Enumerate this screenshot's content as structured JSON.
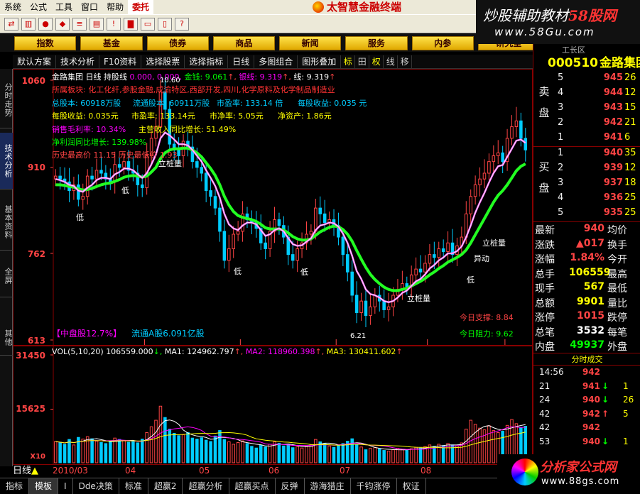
{
  "menu": [
    "系统",
    "公式",
    "工具",
    "窗口",
    "帮助",
    "委托"
  ],
  "app_title": "太智慧金融终端",
  "nav_buttons": [
    "指数",
    "基金",
    "债券",
    "商品",
    "新闻",
    "服务",
    "内参",
    "研究室"
  ],
  "watermark_top": {
    "line1_a": "炒股辅助教材",
    "line1_b": "58股网",
    "line2": "www.58Gu.com"
  },
  "subbar": [
    "默认方案",
    "技术分析",
    "F10资料",
    "选择股票",
    "选择指标",
    "日线",
    "多图组合",
    "图形叠加"
  ],
  "subbar_icons": [
    "标",
    "田",
    "权",
    "线",
    "移"
  ],
  "left_tabs": [
    "分时走势",
    "技术分析",
    "基本资料",
    "全屏",
    "其他"
  ],
  "main_info": {
    "title": "金路集团",
    "period": "日线",
    "line_label": "持股线",
    "vals": "0.000, 0.000,",
    "money_label": "金钱:",
    "money_val": "9.061",
    "gold_label": "银线:",
    "gold_val": "9.319",
    "line_label2": "线:",
    "line_val2": "9.319",
    "sector": "所属板块: 化工化纤,参股金融,成渝特区,西部开发,四川,化学原料及化学制品制造业",
    "total_shares": "总股本: 60918万股",
    "float_shares": "流通股本: 60911万股",
    "pe": "市盈率: 133.14 倍",
    "eps": "每股收益: 0.035 元",
    "eps2": "每股收益: 0.035元",
    "mktpe": "市盈率: 133.14元",
    "pb": "市净率: 5.05元",
    "nav": "净资产: 1.86元",
    "gross_margin": "销售毛利率: 10.34%",
    "rev_growth": "主营收入同比增长: 51.49%",
    "profit_growth": "净利润同比增长: 139.98%",
    "hist_high": "历史最高价 11.15 历史最低价 1.93",
    "cap_type": "【中盘股12.7%】",
    "float_cap": "流通A股6.091亿股",
    "support": "今日支撑: 8.84",
    "resistance": "今日阻力: 9.62",
    "price_hi_note": "10.60",
    "price_lo_note": "6.21"
  },
  "main_ylabels": [
    "1060",
    "910",
    "762",
    "613"
  ],
  "annotations": {
    "low": "低",
    "lizhuang": "立桩量",
    "yidong": "异动"
  },
  "vol_info": {
    "label": "VOL(5,10,20)",
    "vol": "106559.000",
    "ma1": "MA1: 124962.797",
    "ma2": "MA2: 118960.398",
    "ma3": "MA3: 130411.602"
  },
  "vol_ylabels": [
    "31450",
    "15625",
    "X10"
  ],
  "dates": [
    "2010/03",
    "04",
    "05",
    "06",
    "07",
    "08"
  ],
  "day_label": "日线",
  "bottom_tabs": [
    "指标",
    "模板",
    "I",
    "Dde决策",
    "标准",
    "超赢2",
    "超赢分析",
    "超赢买点",
    "反弹",
    "游海猎庄",
    "千钧涨停",
    "权证"
  ],
  "quote": {
    "code": "000510",
    "name": "金路集团",
    "right_tag": "工长区",
    "sell_label": "卖盘",
    "buy_label": "买盘",
    "sell": [
      {
        "n": "5",
        "p": "945",
        "v": "26"
      },
      {
        "n": "4",
        "p": "944",
        "v": "12"
      },
      {
        "n": "3",
        "p": "943",
        "v": "15"
      },
      {
        "n": "2",
        "p": "942",
        "v": "21"
      },
      {
        "n": "1",
        "p": "941",
        "v": "6"
      }
    ],
    "buy": [
      {
        "n": "1",
        "p": "940",
        "v": "35"
      },
      {
        "n": "2",
        "p": "939",
        "v": "12"
      },
      {
        "n": "3",
        "p": "937",
        "v": "18"
      },
      {
        "n": "4",
        "p": "936",
        "v": "25"
      },
      {
        "n": "5",
        "p": "935",
        "v": "25"
      }
    ],
    "stats": [
      {
        "k": "最新",
        "v": "940",
        "c": "#f44",
        "k2": "均价"
      },
      {
        "k": "涨跌",
        "v": "▲017",
        "c": "#f44",
        "k2": "换手"
      },
      {
        "k": "涨幅",
        "v": "1.84%",
        "c": "#f44",
        "k2": "今开"
      },
      {
        "k": "总手",
        "v": "106559",
        "c": "#ff0",
        "k2": "最高"
      },
      {
        "k": "现手",
        "v": "567",
        "c": "#ff0",
        "k2": "最低"
      },
      {
        "k": "总额",
        "v": "9901",
        "c": "#ff0",
        "k2": "量比"
      },
      {
        "k": "涨停",
        "v": "1015",
        "c": "#f44",
        "k2": "跌停"
      },
      {
        "k": "总笔",
        "v": "3532",
        "c": "#fff",
        "k2": "每笔"
      },
      {
        "k": "内盘",
        "v": "49937",
        "c": "#0f0",
        "k2": "外盘"
      }
    ],
    "ticks_title": "分时成交",
    "ticks": [
      {
        "t": "14:56",
        "p": "942",
        "a": "",
        "v": ""
      },
      {
        "t": "21",
        "p": "941",
        "a": "↓",
        "v": "1"
      },
      {
        "t": "24",
        "p": "940",
        "a": "↓",
        "v": "26"
      },
      {
        "t": "42",
        "p": "942",
        "a": "↑",
        "v": "5"
      },
      {
        "t": "42",
        "p": "942",
        "a": "",
        "v": ""
      },
      {
        "t": "53",
        "p": "940",
        "a": "↓",
        "v": "1"
      }
    ]
  },
  "logo_bottom": {
    "line1": "分析家公式网",
    "line2": "www.88gs.com"
  },
  "chart_data": {
    "type": "candlestick",
    "title": "金路集团 日线",
    "ylim": [
      6.13,
      10.6
    ],
    "yticks": [
      10.6,
      9.1,
      7.62,
      6.13
    ],
    "x_start": "2010/03",
    "x_month_labels": [
      "2010/03",
      "04",
      "05",
      "06",
      "07",
      "08"
    ],
    "close": [
      8.95,
      8.9,
      8.85,
      8.7,
      8.8,
      8.55,
      8.6,
      8.95,
      8.9,
      9.05,
      9.0,
      8.9,
      8.85,
      9.15,
      9.1,
      9.2,
      9.05,
      9.0,
      8.8,
      8.75,
      9.3,
      9.6,
      9.8,
      10.4,
      10.1,
      9.5,
      9.4,
      9.3,
      9.55,
      9.45,
      9.2,
      9.1,
      9.0,
      8.7,
      8.6,
      8.4,
      8.0,
      7.5,
      7.7,
      7.95,
      8.0,
      8.3,
      8.2,
      8.15,
      8.05,
      7.8,
      7.7,
      8.0,
      8.2,
      8.1,
      7.9,
      7.6,
      7.5,
      7.7,
      7.8,
      7.95,
      8.0,
      8.4,
      8.3,
      8.15,
      8.2,
      8.1,
      7.9,
      7.6,
      7.3,
      6.9,
      6.6,
      6.8,
      6.55,
      6.7,
      6.9,
      6.8,
      6.65,
      6.7,
      6.9,
      7.0,
      7.1,
      7.05,
      7.25,
      7.35,
      7.3,
      7.45,
      7.6,
      7.55,
      7.7,
      7.65,
      7.8,
      7.6,
      7.75,
      7.9,
      8.3,
      8.6,
      8.8,
      8.9,
      9.0,
      9.2,
      9.3,
      9.35,
      9.2,
      9.6,
      9.8,
      9.9,
      9.6,
      9.4
    ],
    "silver_line": [
      8.9,
      8.88,
      8.85,
      8.8,
      8.78,
      8.7,
      8.68,
      8.75,
      8.8,
      8.88,
      8.92,
      8.92,
      8.9,
      8.98,
      9.02,
      9.08,
      9.08,
      9.05,
      8.98,
      8.92,
      9.0,
      9.15,
      9.32,
      9.6,
      9.7,
      9.65,
      9.58,
      9.5,
      9.5,
      9.48,
      9.4,
      9.3,
      9.2,
      9.05,
      8.92,
      8.78,
      8.58,
      8.3,
      8.12,
      8.05,
      8.02,
      8.1,
      8.15,
      8.15,
      8.12,
      8.02,
      7.92,
      7.95,
      8.02,
      8.05,
      8.0,
      7.88,
      7.78,
      7.75,
      7.76,
      7.82,
      7.88,
      8.02,
      8.1,
      8.12,
      8.15,
      8.14,
      8.08,
      7.96,
      7.8,
      7.58,
      7.32,
      7.18,
      7.0,
      6.92,
      6.9,
      6.86,
      6.8,
      6.78,
      6.8,
      6.86,
      6.94,
      6.98,
      7.06,
      7.14,
      7.18,
      7.26,
      7.36,
      7.42,
      7.5,
      7.55,
      7.62,
      7.62,
      7.66,
      7.74,
      7.9,
      8.1,
      8.32,
      8.5,
      8.66,
      8.84,
      9.0,
      9.12,
      9.14,
      9.28,
      9.42,
      9.56,
      9.58,
      9.52
    ],
    "gold_line": [
      8.8,
      8.8,
      8.79,
      8.77,
      8.76,
      8.73,
      8.71,
      8.72,
      8.74,
      8.77,
      8.8,
      8.82,
      8.83,
      8.86,
      8.89,
      8.93,
      8.95,
      8.96,
      8.95,
      8.93,
      8.95,
      9.02,
      9.1,
      9.25,
      9.35,
      9.4,
      9.42,
      9.42,
      9.43,
      9.43,
      9.4,
      9.35,
      9.28,
      9.18,
      9.08,
      8.96,
      8.8,
      8.6,
      8.45,
      8.34,
      8.27,
      8.24,
      8.22,
      8.2,
      8.17,
      8.12,
      8.06,
      8.04,
      8.04,
      8.04,
      8.02,
      7.97,
      7.91,
      7.87,
      7.85,
      7.85,
      7.87,
      7.93,
      7.99,
      8.03,
      8.07,
      8.09,
      8.08,
      8.03,
      7.95,
      7.83,
      7.67,
      7.52,
      7.38,
      7.26,
      7.17,
      7.1,
      7.04,
      7.0,
      6.98,
      6.98,
      7.0,
      7.02,
      7.06,
      7.1,
      7.14,
      7.19,
      7.25,
      7.3,
      7.36,
      7.41,
      7.47,
      7.51,
      7.55,
      7.6,
      7.68,
      7.8,
      7.94,
      8.08,
      8.22,
      8.36,
      8.5,
      8.62,
      8.7,
      8.8,
      8.92,
      9.04,
      9.12,
      9.16
    ],
    "volume": [
      6200,
      5800,
      5400,
      6800,
      5200,
      7400,
      6900,
      7600,
      7000,
      6300,
      5900,
      5600,
      6100,
      7200,
      6800,
      6500,
      6000,
      6200,
      5800,
      6900,
      8800,
      10500,
      12400,
      16500,
      13200,
      9800,
      8600,
      7900,
      8200,
      8800,
      7200,
      6900,
      7300,
      6600,
      6200,
      7800,
      9400,
      6800,
      6100,
      5400,
      5900,
      6400,
      5600,
      4800,
      4300,
      5200,
      4600,
      5400,
      6100,
      5700,
      4900,
      5300,
      4400,
      4700,
      4300,
      4900,
      5200,
      6800,
      6100,
      5600,
      4900,
      4500,
      5100,
      5600,
      6300,
      7000,
      5200,
      4600,
      3800,
      4200,
      4500,
      4000,
      3600,
      3400,
      3800,
      4200,
      3900,
      3600,
      4100,
      4500,
      4300,
      4700,
      5200,
      4800,
      5400,
      5000,
      5600,
      5200,
      4900,
      5800,
      9800,
      12400,
      11200,
      10100,
      9600,
      10800,
      9400,
      8800,
      9200,
      10900,
      12600,
      11400,
      10200,
      10656
    ],
    "vol_ylim": [
      0,
      31450
    ],
    "vol_yticks": [
      31450,
      15625
    ]
  }
}
